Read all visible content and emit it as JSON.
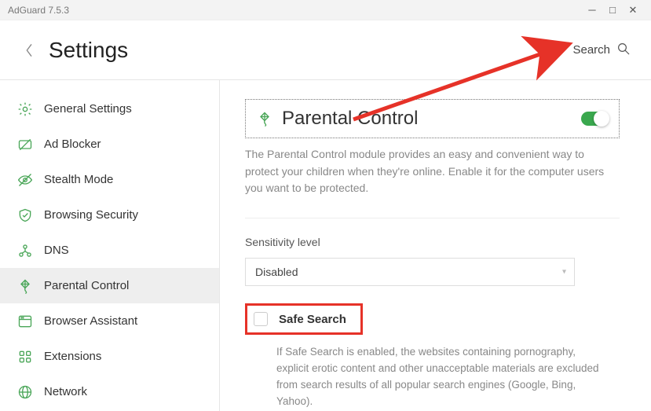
{
  "window": {
    "title": "AdGuard 7.5.3"
  },
  "header": {
    "title": "Settings",
    "search_label": "Search"
  },
  "sidebar": {
    "items": [
      {
        "label": "General Settings"
      },
      {
        "label": "Ad Blocker"
      },
      {
        "label": "Stealth Mode"
      },
      {
        "label": "Browsing Security"
      },
      {
        "label": "DNS"
      },
      {
        "label": "Parental Control"
      },
      {
        "label": "Browser Assistant"
      },
      {
        "label": "Extensions"
      },
      {
        "label": "Network"
      }
    ]
  },
  "panel": {
    "title": "Parental Control",
    "description": "The Parental Control module provides an easy and convenient way to protect your children when they're online. Enable it for the computer users you want to be protected.",
    "toggle_on": true,
    "sensitivity_label": "Sensitivity level",
    "sensitivity_value": "Disabled",
    "safe_search_label": "Safe Search",
    "safe_search_checked": false,
    "safe_search_desc": "If Safe Search is enabled, the websites containing pornography, explicit erotic content and other unacceptable materials are excluded from search results of all popular search engines (Google, Bing, Yahoo)."
  }
}
